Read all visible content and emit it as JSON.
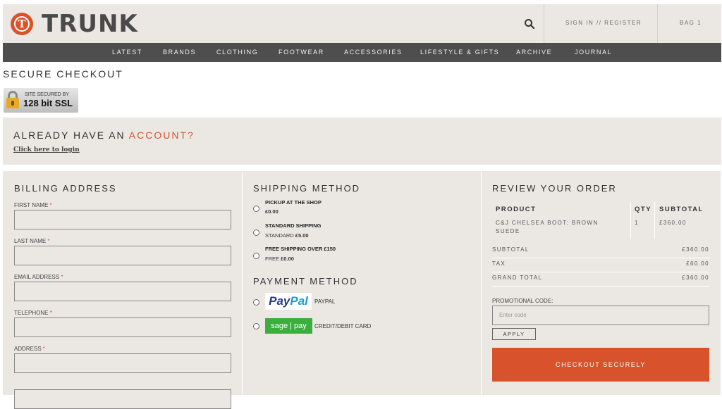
{
  "header": {
    "logo_letter": "T",
    "logo_text": "TRUNK",
    "sign_in_label": "SIGN IN // REGISTER",
    "bag_label": "BAG 1"
  },
  "nav": {
    "items": [
      "LATEST",
      "BRANDS",
      "CLOTHING",
      "FOOTWEAR",
      "ACCESSORIES",
      "LIFESTYLE & GIFTS",
      "ARCHIVE",
      "JOURNAL"
    ]
  },
  "page_title": "SECURE CHECKOUT",
  "ssl_badge": {
    "small": "SITE SECURED BY",
    "big": "128 bit SSL"
  },
  "account": {
    "heading_prefix": "ALREADY HAVE AN ",
    "heading_accent": "ACCOUNT?",
    "login_link": "Click here to login"
  },
  "billing": {
    "heading": "BILLING ADDRESS",
    "fields": [
      {
        "label": "FIRST NAME",
        "required": "*"
      },
      {
        "label": "LAST NAME",
        "required": "*"
      },
      {
        "label": "EMAIL ADDRESS",
        "required": "*"
      },
      {
        "label": "TELEPHONE",
        "required": "*"
      },
      {
        "label": "ADDRESS",
        "required": "*"
      }
    ]
  },
  "shipping": {
    "heading": "SHIPPING METHOD",
    "options": [
      {
        "title": "PICKUP AT THE SHOP",
        "sub_prefix": "",
        "sub_price": "£0.00"
      },
      {
        "title": "STANDARD SHIPPING",
        "sub_prefix": "STANDARD ",
        "sub_price": "£5.00"
      },
      {
        "title": "FREE SHIPPING OVER £150",
        "sub_prefix": "FREE ",
        "sub_price": "£0.00"
      }
    ]
  },
  "payment": {
    "heading": "PAYMENT METHOD",
    "paypal_logo_a": "Pay",
    "paypal_logo_b": "Pal",
    "paypal_label": "PAYPAL",
    "sagepay_logo": "sage | pay",
    "card_label": "CREDIT/DEBIT CARD"
  },
  "review": {
    "heading": "REVIEW YOUR ORDER",
    "columns": [
      "PRODUCT",
      "QTY",
      "SUBTOTAL"
    ],
    "item": {
      "product": "C&J CHELSEA BOOT: BROWN SUEDE",
      "qty": "1",
      "subtotal": "£360.00"
    },
    "totals": [
      {
        "label": "SUBTOTAL",
        "value": "£360.00"
      },
      {
        "label": "TAX",
        "value": "£60.00"
      },
      {
        "label": "GRAND TOTAL",
        "value": "£360.00"
      }
    ],
    "promo_label": "PROMOTIONAL CODE:",
    "promo_placeholder": "Enter code",
    "apply_label": "APPLY",
    "checkout_label": "CHECKOUT SECURELY"
  },
  "colors": {
    "accent": "#d8532b",
    "panel": "#ebe8e4",
    "nav": "#4e4e4e"
  }
}
